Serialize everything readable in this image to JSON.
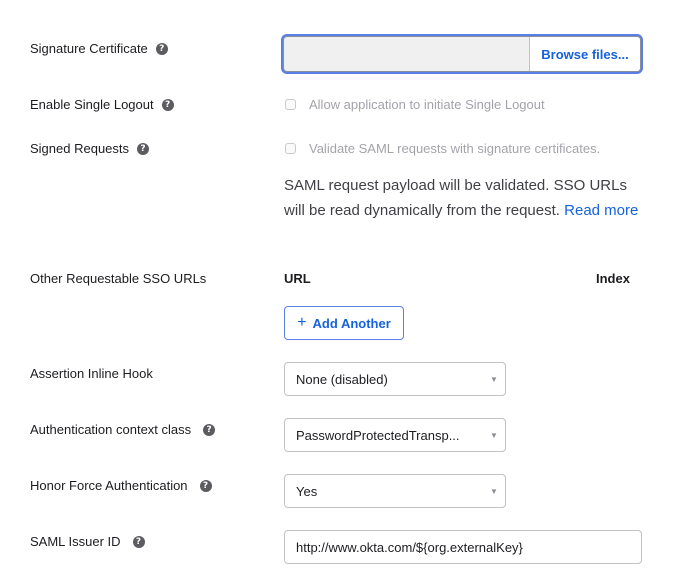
{
  "signature_certificate": {
    "label": "Signature Certificate",
    "browse_label": "Browse files..."
  },
  "single_logout": {
    "label": "Enable Single Logout",
    "checkbox_label": "Allow application to initiate Single Logout",
    "checked": false
  },
  "signed_requests": {
    "label": "Signed Requests",
    "checkbox_label": "Validate SAML requests with signature certificates.",
    "checked": false,
    "description": "SAML request payload will be validated. SSO URLs will be read dynamically from the request.",
    "read_more": "Read more"
  },
  "sso_urls": {
    "label": "Other Requestable SSO URLs",
    "columns": [
      "URL",
      "Index"
    ],
    "add_label": "Add Another",
    "add_icon": "plus-icon"
  },
  "assertion_hook": {
    "label": "Assertion Inline Hook",
    "value": "None (disabled)"
  },
  "auth_context": {
    "label": "Authentication context class",
    "value": "PasswordProtectedTransp..."
  },
  "force_auth": {
    "label": "Honor Force Authentication",
    "value": "Yes"
  },
  "issuer_id": {
    "label": "SAML Issuer ID",
    "value": "http://www.okta.com/${org.externalKey}"
  },
  "colors": {
    "accent": "#1662dd",
    "focus_ring": "#5b7fe8",
    "help_icon": "#5c5c60"
  }
}
